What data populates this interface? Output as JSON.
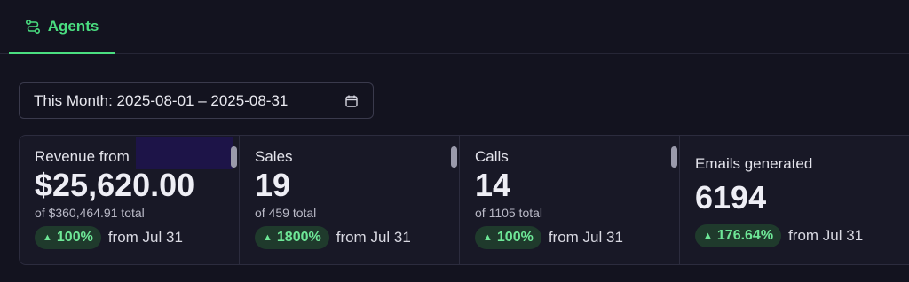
{
  "tabs": [
    {
      "label": "Agents",
      "icon": "agents-route-icon",
      "active": true
    }
  ],
  "date_picker": {
    "label": "This Month: 2025-08-01 – 2025-08-31",
    "icon": "calendar-icon"
  },
  "accent_color": "#4ade80",
  "metrics": [
    {
      "title": "Revenue from",
      "value": "$25,620.00",
      "subtitle": "of $360,464.91 total",
      "change": "100%",
      "change_direction": "up",
      "comparison": "from Jul 31"
    },
    {
      "title": "Sales",
      "value": "19",
      "subtitle": "of 459 total",
      "change": "1800%",
      "change_direction": "up",
      "comparison": "from Jul 31"
    },
    {
      "title": "Calls",
      "value": "14",
      "subtitle": "of 1105 total",
      "change": "100%",
      "change_direction": "up",
      "comparison": "from Jul 31"
    },
    {
      "title": "Emails generated",
      "value": "6194",
      "change": "176.64%",
      "change_direction": "up",
      "comparison": "from Jul 31"
    }
  ]
}
